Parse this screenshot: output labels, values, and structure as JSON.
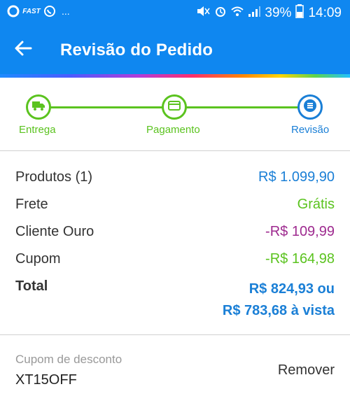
{
  "status_bar": {
    "notification_icons": [
      "opera-icon",
      "fast-icon",
      "whatsapp-icon"
    ],
    "more": "...",
    "battery_percent": "39%",
    "time": "14:09"
  },
  "app_bar": {
    "title": "Revisão do Pedido"
  },
  "stepper": {
    "steps": [
      {
        "label": "Entrega",
        "icon": "truck-icon",
        "state": "done"
      },
      {
        "label": "Pagamento",
        "icon": "card-icon",
        "state": "done"
      },
      {
        "label": "Revisão",
        "icon": "list-icon",
        "state": "current"
      }
    ]
  },
  "summary": {
    "rows": [
      {
        "label": "Produtos (1)",
        "value": "R$ 1.099,90",
        "color": "#1a7fd6"
      },
      {
        "label": "Frete",
        "value": "Grátis",
        "color": "#5bc31f"
      },
      {
        "label": "Cliente Ouro",
        "value": "-R$ 109,99",
        "color": "#9e2a8f"
      },
      {
        "label": "Cupom",
        "value": "-R$ 164,98",
        "color": "#5bc31f"
      }
    ],
    "total": {
      "label": "Total",
      "value_line1": "R$ 824,93 ou",
      "value_line2": "R$ 783,68 à vista"
    }
  },
  "coupon": {
    "label": "Cupom de desconto",
    "code": "XT15OFF",
    "remove_label": "Remover"
  },
  "colors": {
    "primary": "#0f87f0",
    "accent_green": "#5bc31f",
    "accent_blue": "#1a7fd6",
    "accent_purple": "#9e2a8f"
  }
}
